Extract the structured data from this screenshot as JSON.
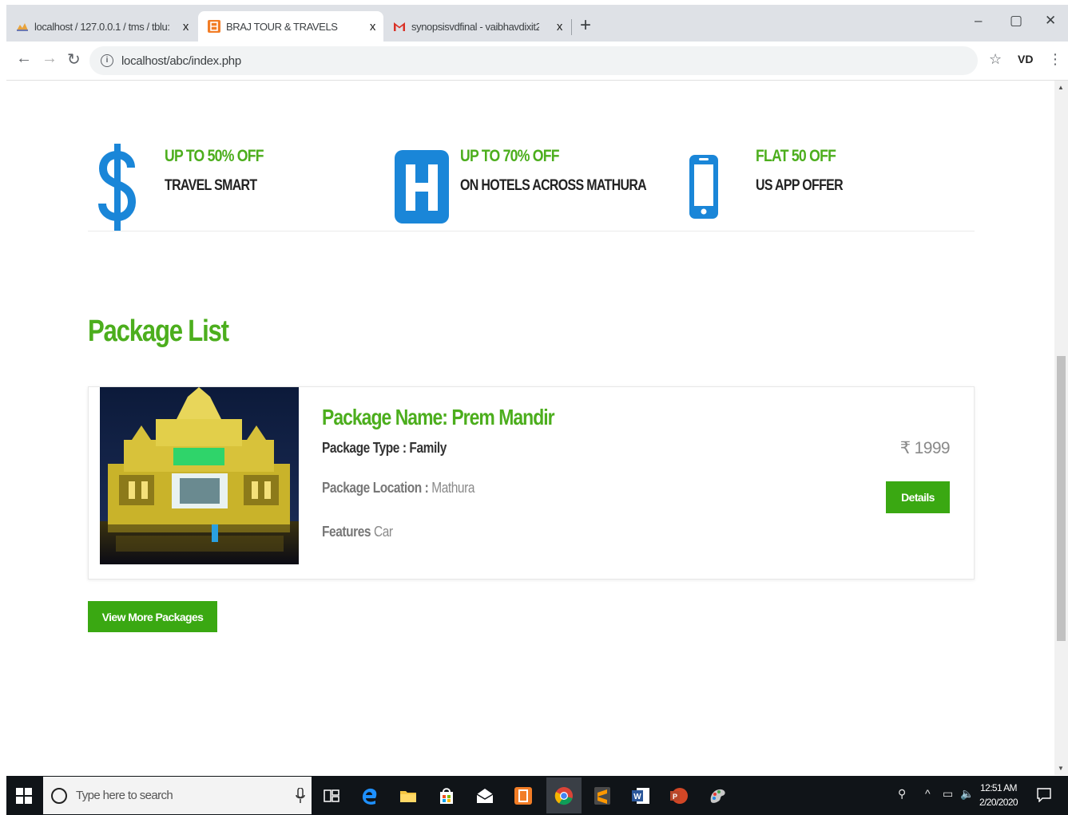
{
  "browser": {
    "tabs": [
      {
        "title": "localhost / 127.0.0.1 / tms / tblu:",
        "active": false
      },
      {
        "title": "BRAJ TOUR & TRAVELS",
        "active": true
      },
      {
        "title": "synopsisvdfinal - vaibhavdixit29:",
        "active": false
      }
    ],
    "tab_close_glyph": "x",
    "new_tab_glyph": "+",
    "url": "localhost/abc/index.php"
  },
  "offers": [
    {
      "icon": "dollar-icon",
      "headline": "UP TO 50% OFF",
      "subline": "TRAVEL SMART"
    },
    {
      "icon": "hotel-icon",
      "headline": "UP TO 70% OFF",
      "subline": "ON HOTELS ACROSS MATHURA"
    },
    {
      "icon": "mobile-icon",
      "headline": "FLAT 50 OFF",
      "subline": "US APP OFFER"
    }
  ],
  "section_title": "Package List",
  "package": {
    "name": "Package Name: Prem Mandir",
    "type_label": "Package Type :",
    "type_value": "Family",
    "location_label": "Package Location :",
    "location_value": "Mathura",
    "features_label": "Features",
    "features_value": "Car",
    "price": "₹ 1999",
    "details_label": "Details"
  },
  "view_more_label": "View More Packages",
  "taskbar": {
    "search_placeholder": "Type here to search",
    "time": "12:51 AM",
    "date": "2/20/2020"
  },
  "colors": {
    "accent_green": "#4cae1d",
    "button_green": "#3aa812"
  }
}
